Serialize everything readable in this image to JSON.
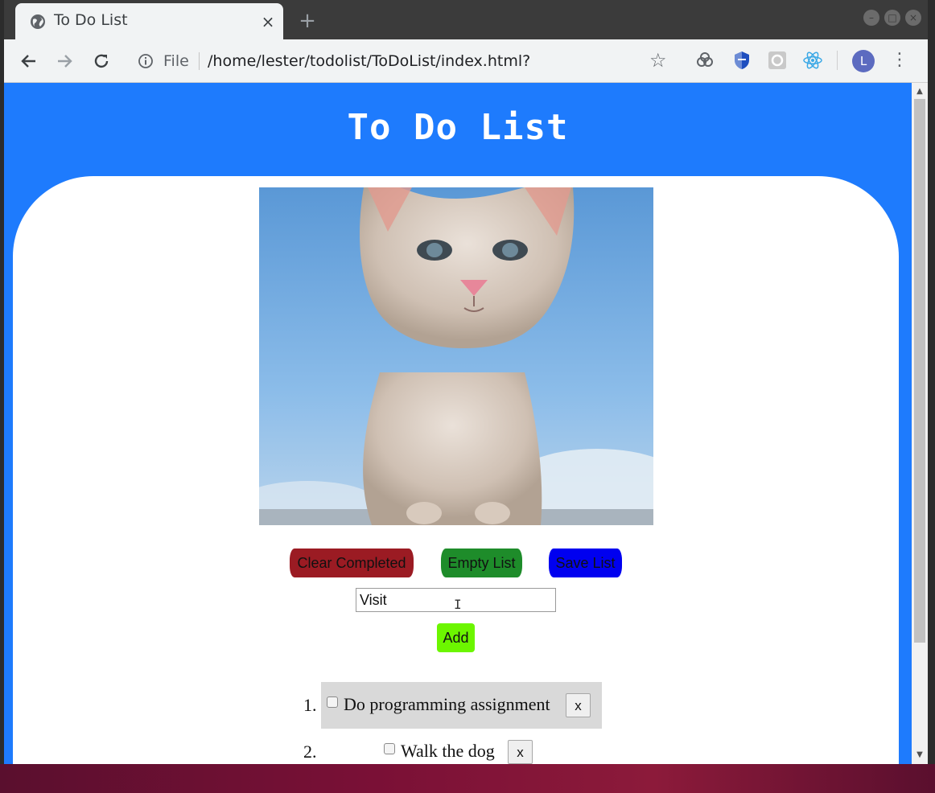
{
  "browser": {
    "tab_title": "To Do List",
    "tab_close": "×",
    "new_tab": "+",
    "scheme_label": "File",
    "url": "/home/lester/todolist/ToDoList/index.html?",
    "avatar_initial": "L"
  },
  "page": {
    "heading": "To Do List",
    "buttons": {
      "clear_completed": "Clear Completed",
      "empty_list": "Empty List",
      "save_list": "Save List",
      "add": "Add"
    },
    "input_value": "Visit",
    "todos": [
      {
        "num": "1.",
        "text": "Do programming assignment",
        "delete": "x"
      },
      {
        "num": "2.",
        "text": "Walk the dog",
        "delete": "x"
      }
    ]
  },
  "colors": {
    "page_background": "#1e7bfd",
    "clear_completed_bg": "#9b1b23",
    "empty_list_bg": "#1e8c2a",
    "save_list_bg": "#0000f0",
    "add_bg": "#6cf600",
    "completed_item_bg": "#d9d9d9"
  },
  "icons": {
    "tab": "globe-icon",
    "back": "back-arrow-icon",
    "forward": "forward-arrow-icon",
    "reload": "reload-icon",
    "info": "info-icon",
    "bookmark": "star-icon",
    "menu": "more-vert-icon"
  }
}
